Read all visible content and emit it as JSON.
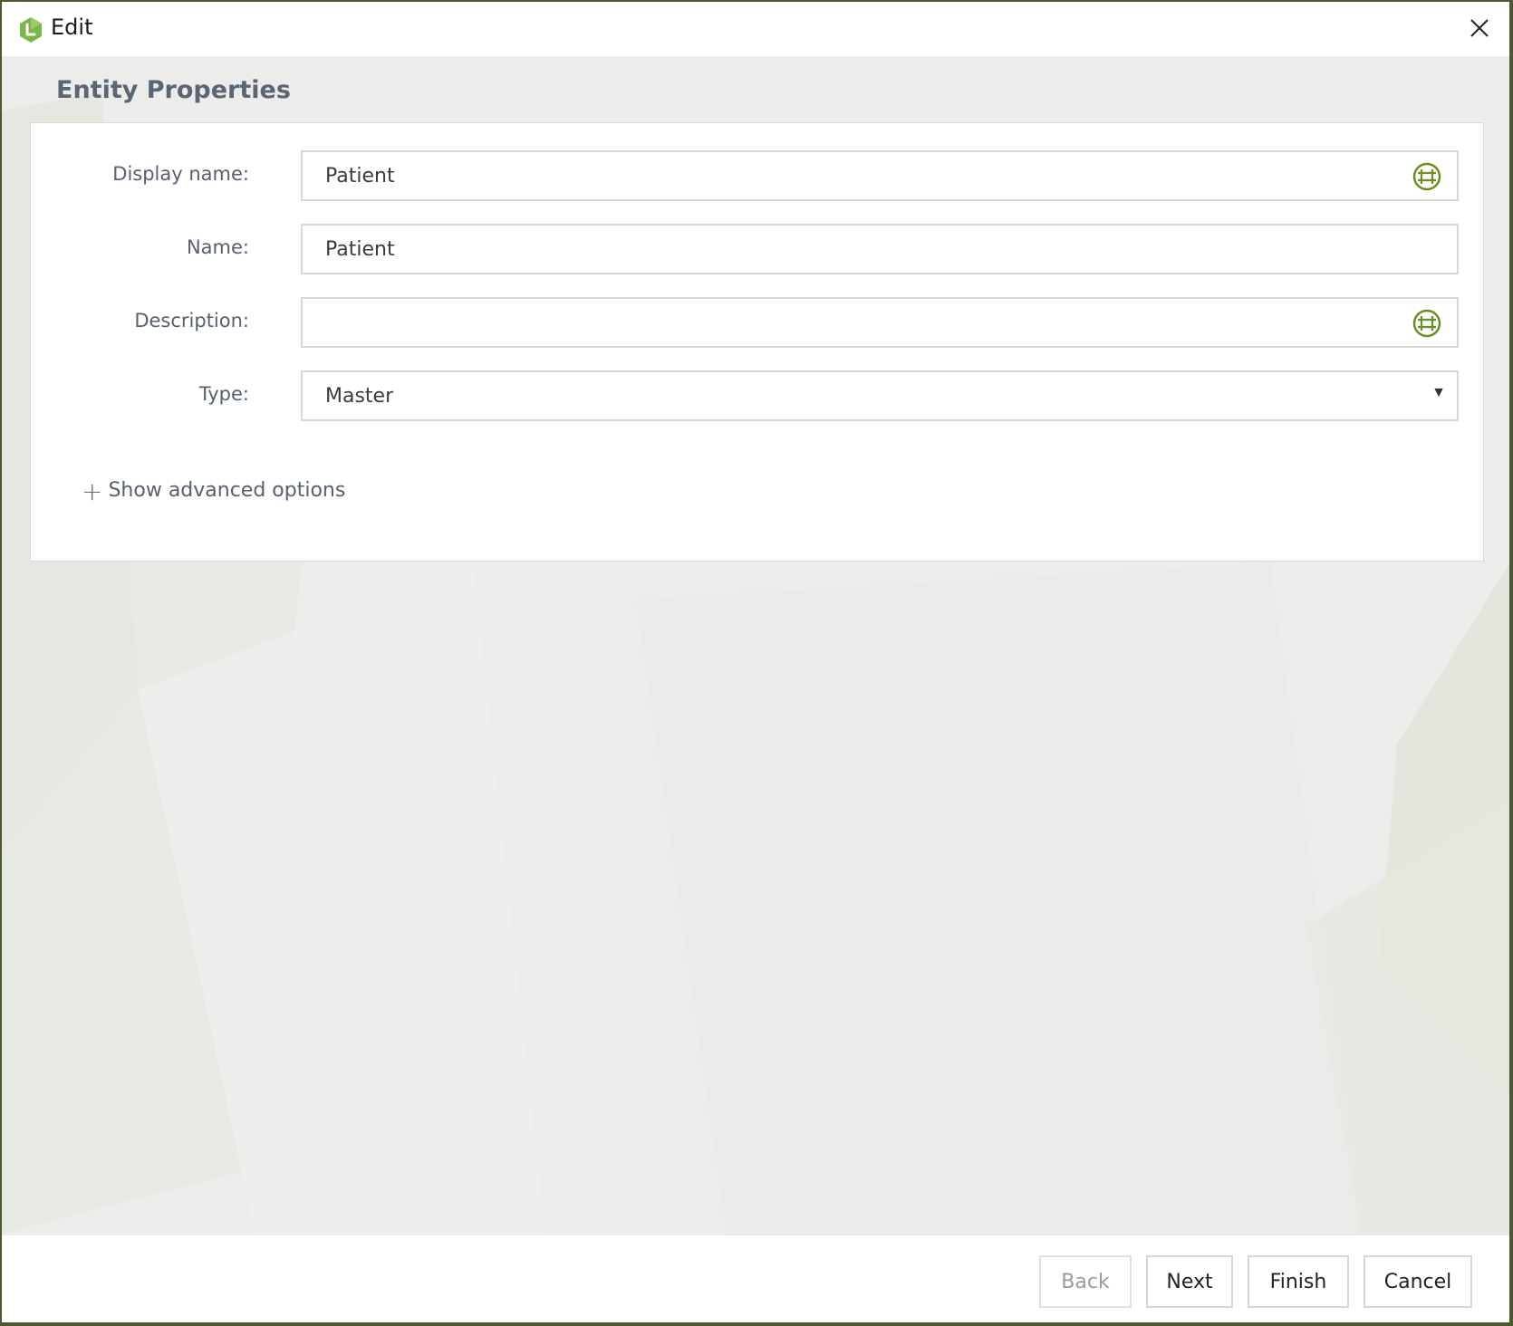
{
  "window": {
    "title": "Edit",
    "accent_color": "#7ab648"
  },
  "header": {
    "section_title": "Entity Properties"
  },
  "form": {
    "display_name": {
      "label": "Display name:",
      "value": "Patient"
    },
    "name": {
      "label": "Name:",
      "value": "Patient"
    },
    "description": {
      "label": "Description:",
      "value": ""
    },
    "type": {
      "label": "Type:",
      "value": "Master"
    },
    "advanced_toggle": "Show advanced options"
  },
  "footer": {
    "back_label": "Back",
    "next_label": "Next",
    "finish_label": "Finish",
    "cancel_label": "Cancel"
  }
}
